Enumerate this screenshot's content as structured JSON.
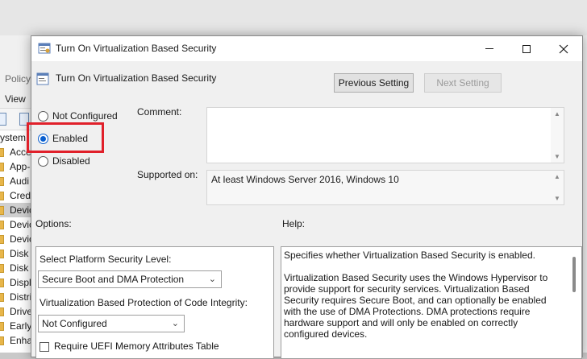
{
  "background_window": {
    "menu_title": "Policy",
    "menu_view": "View",
    "tree_items": [
      "ystem",
      "Acce",
      "App-",
      "Audi",
      "Cred",
      "Devic",
      "Devic",
      "Devic",
      "Disk",
      "Disk",
      "Displ",
      "Distri",
      "Drive",
      "Early",
      "Enha"
    ],
    "selected_index": 5
  },
  "dialog": {
    "title": "Turn On Virtualization Based Security",
    "header_title": "Turn On Virtualization Based Security",
    "previous_setting_label": "Previous Setting",
    "next_setting_label": "Next Setting",
    "radios": {
      "not_configured": "Not Configured",
      "enabled": "Enabled",
      "disabled": "Disabled",
      "selected": "enabled"
    },
    "comment_label": "Comment:",
    "comment_value": "",
    "supported_on_label": "Supported on:",
    "supported_on_value": "At least Windows Server 2016, Windows 10",
    "options_label": "Options:",
    "help_label": "Help:",
    "options": {
      "platform_level_label": "Select Platform Security Level:",
      "platform_level_value": "Secure Boot and DMA Protection",
      "code_integrity_label": "Virtualization Based Protection of Code Integrity:",
      "code_integrity_value": "Not Configured",
      "uefi_checkbox_label": "Require UEFI Memory Attributes Table"
    },
    "help": {
      "paragraph_1": "Specifies whether Virtualization Based Security is enabled.",
      "paragraph_2": "Virtualization Based Security uses the Windows Hypervisor to provide support for security services. Virtualization Based Security requires Secure Boot, and can optionally be enabled with the use of DMA Protections. DMA protections require hardware support and will only be enabled on correctly configured devices."
    }
  },
  "colors": {
    "highlight_border": "#e0202a",
    "radio_selected": "#0a5fcf",
    "dialog_bg": "#f0f0f0"
  },
  "icons": [
    "policy-icon",
    "minimize-icon",
    "maximize-icon",
    "close-icon",
    "chevron-down-icon",
    "folder-icon"
  ]
}
